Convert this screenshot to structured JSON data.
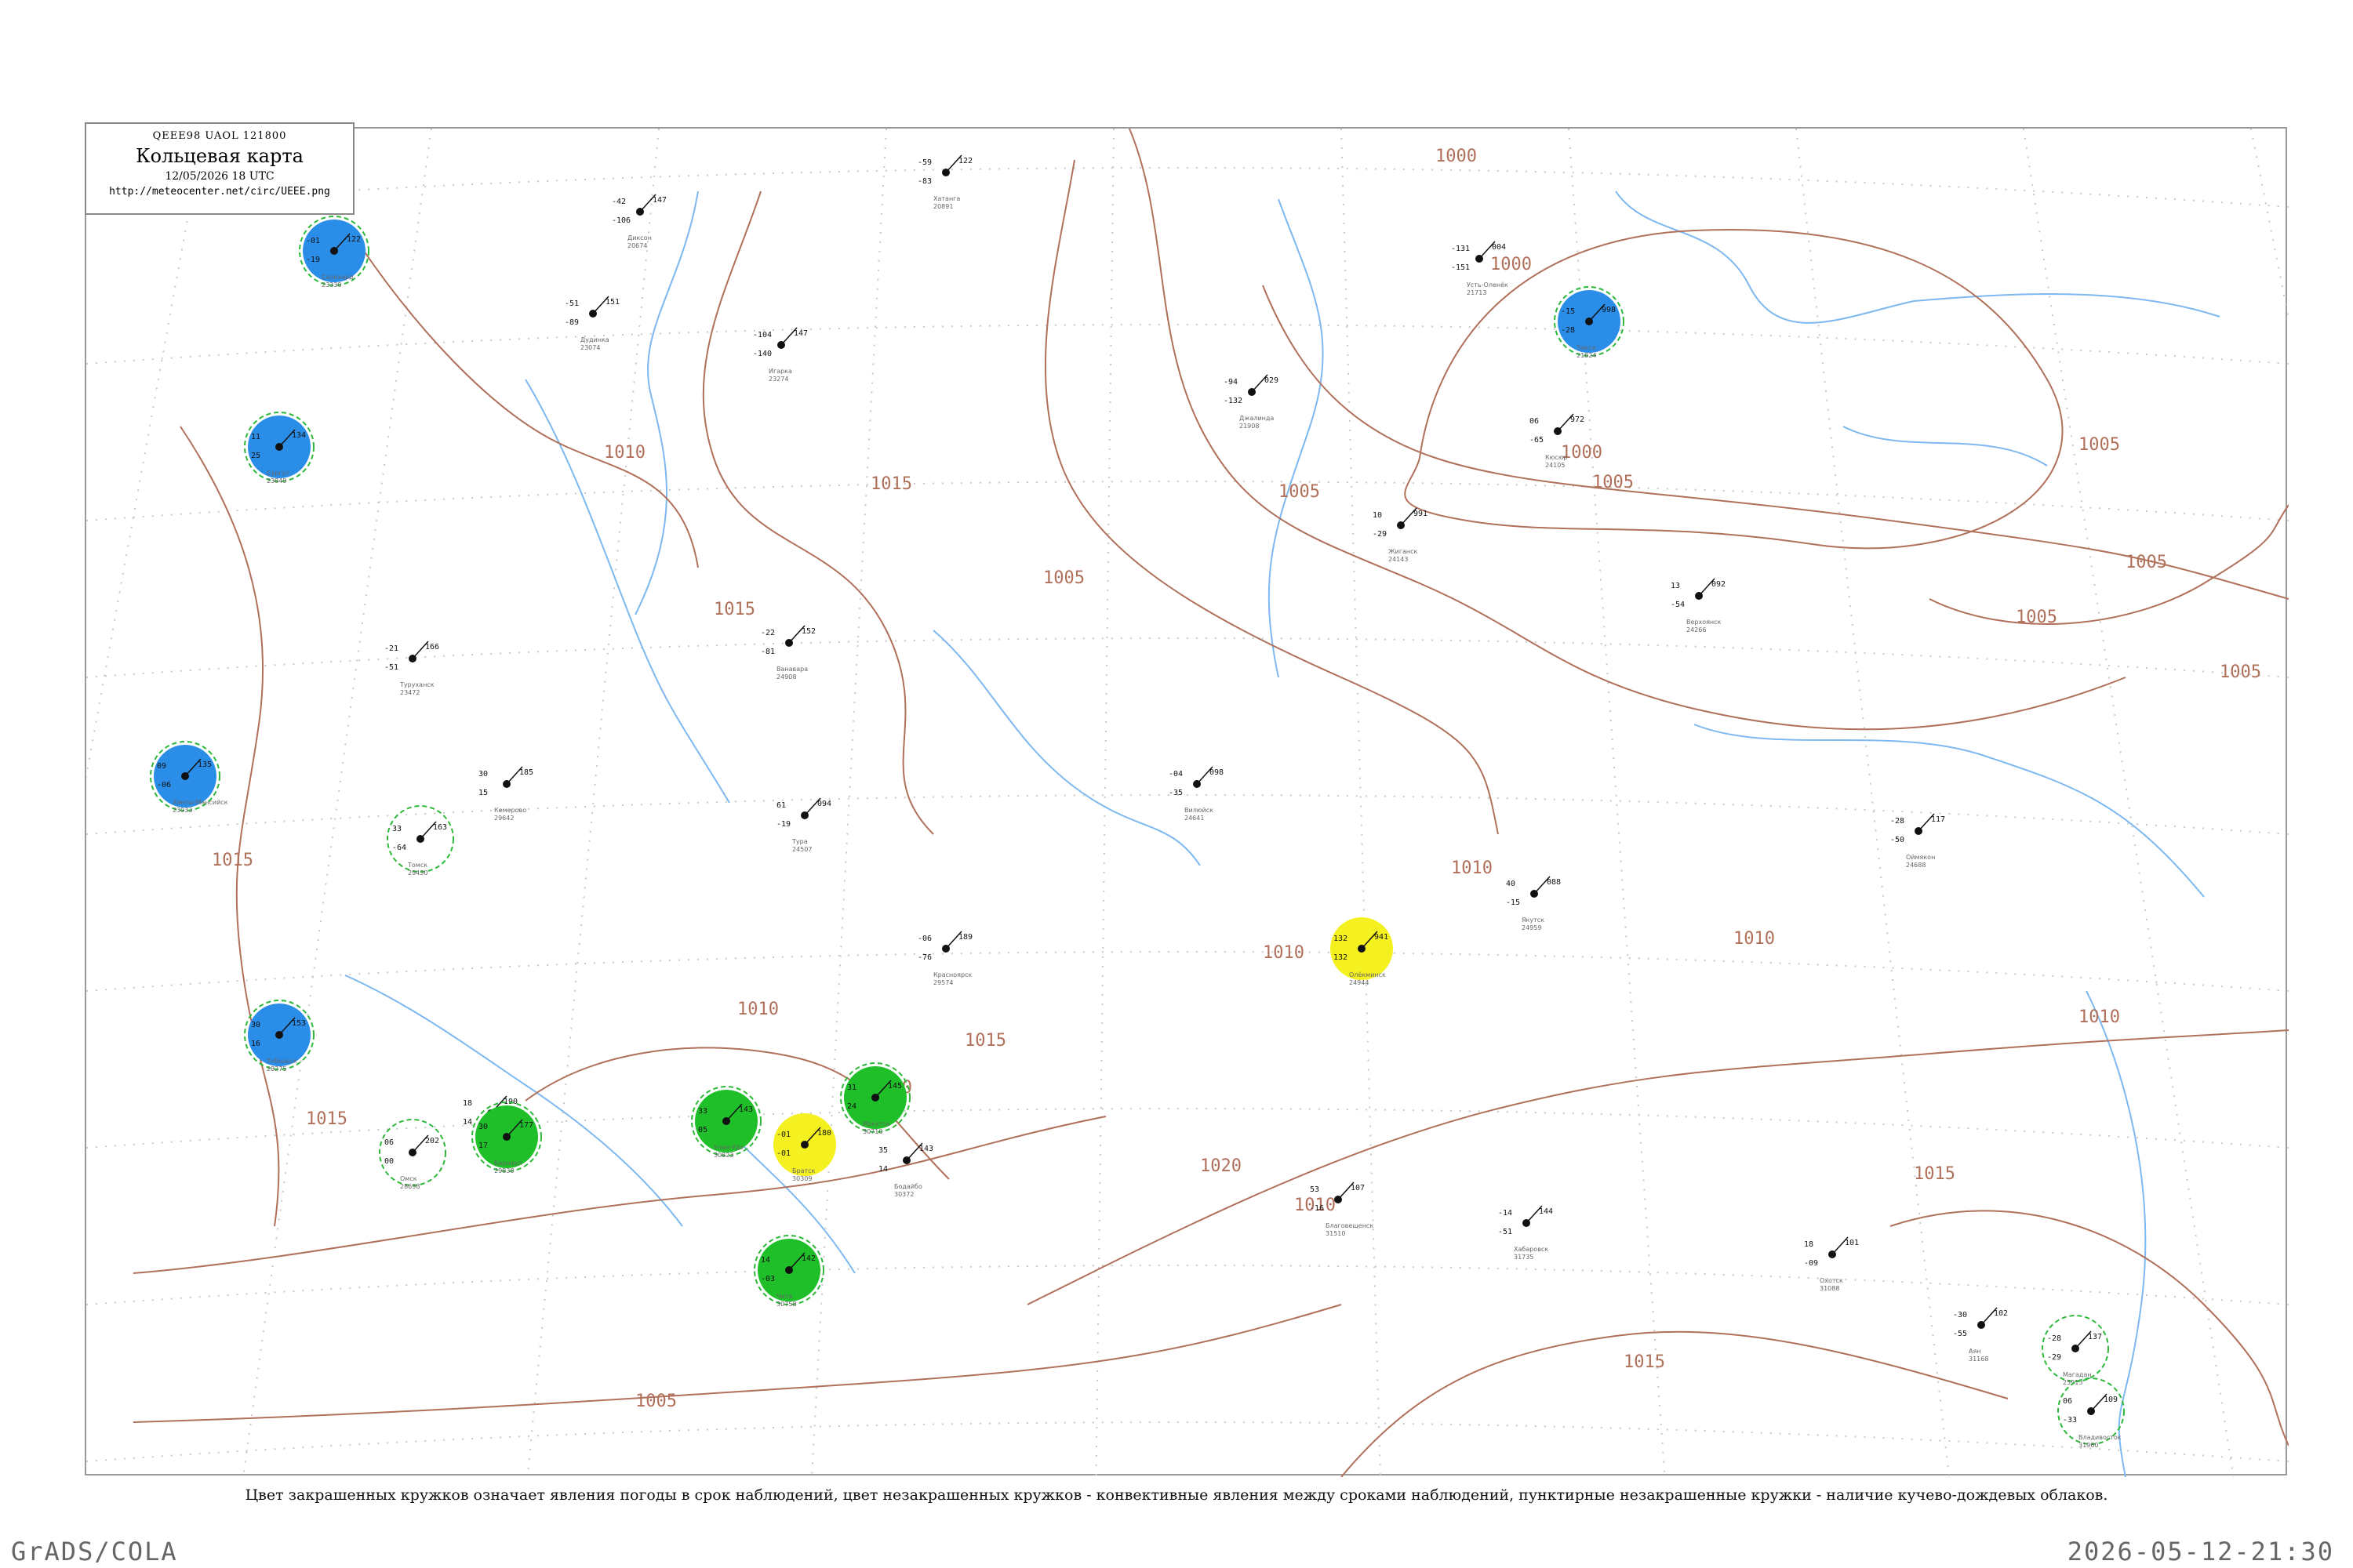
{
  "header": {
    "code_line": "QEEE98  UAOL  121800",
    "title": "Кольцевая карта",
    "date": "12/05/2026 18 UTC",
    "url": "http://meteocenter.net/circ/UEEE.png"
  },
  "caption": "Цвет закрашенных кружков означает явления погоды в срок наблюдений, цвет незакрашенных кружков - конвективные явления между сроками наблюдений, пунктирные незакрашенные кружки - наличие кучево-дождевых облаков.",
  "footer": {
    "left": "GrADS/COLA",
    "right": "2026-05-12-21:30"
  },
  "colors": {
    "isobar": "#b0705a",
    "river": "#7db8f0",
    "grid": "#c8c8c8",
    "blue_fill": "#2a8de8",
    "green_fill": "#1fbf2a",
    "yellow_fill": "#f5f020",
    "green_ring": "#2eb83a",
    "light_yellow": "#f8f5a8"
  },
  "isobar_labels": [
    "1000",
    "1000",
    "1000",
    "1005",
    "1005",
    "1005",
    "1005",
    "1005",
    "1005",
    "1005",
    "1010",
    "1010",
    "1010",
    "1010",
    "1010",
    "1010",
    "1010",
    "1010",
    "1015",
    "1015",
    "1015",
    "1015",
    "1015",
    "1015",
    "1015",
    "1020",
    "1005"
  ],
  "stations": [
    {
      "name": "Усть-Оленёк",
      "id": "21713",
      "pressure": "004",
      "temp": "-131",
      "dew": "-151",
      "kind": "none"
    },
    {
      "name": "Тикси",
      "id": "21824",
      "pressure": "998",
      "temp": "-15",
      "dew": "-28",
      "kind": "blue"
    },
    {
      "name": "Кюсюр",
      "id": "24105",
      "pressure": "972",
      "temp": "06",
      "dew": "-65",
      "kind": "none"
    },
    {
      "name": "Джалинда",
      "id": "21908",
      "pressure": "029",
      "temp": "-94",
      "dew": "-132",
      "kind": "none"
    },
    {
      "name": "Хатанга",
      "id": "20891",
      "pressure": "122",
      "temp": "-59",
      "dew": "-83",
      "kind": "none"
    },
    {
      "name": "Верхоянск",
      "id": "24266",
      "pressure": "092",
      "temp": "13",
      "dew": "-54",
      "kind": "none"
    },
    {
      "name": "Жиганск",
      "id": "24143",
      "pressure": "991",
      "temp": "10",
      "dew": "-29",
      "kind": "none"
    },
    {
      "name": "Оймякон",
      "id": "24688",
      "pressure": "117",
      "temp": "-28",
      "dew": "-50",
      "kind": "none"
    },
    {
      "name": "Якутск",
      "id": "24959",
      "pressure": "088",
      "temp": "40",
      "dew": "-15",
      "kind": "none"
    },
    {
      "name": "Олёкминск",
      "id": "24944",
      "pressure": "941",
      "temp": "132",
      "dew": "132",
      "kind": "yellow"
    },
    {
      "name": "Вилюйск",
      "id": "24641",
      "pressure": "098",
      "temp": "-04",
      "dew": "-35",
      "kind": "none"
    },
    {
      "name": "Тура",
      "id": "24507",
      "pressure": "094",
      "temp": "61",
      "dew": "-19",
      "kind": "none"
    },
    {
      "name": "Ванавара",
      "id": "24908",
      "pressure": "152",
      "temp": "-22",
      "dew": "-81",
      "kind": "none"
    },
    {
      "name": "Туруханск",
      "id": "23472",
      "pressure": "166",
      "temp": "-21",
      "dew": "-51",
      "kind": "none"
    },
    {
      "name": "Диксон",
      "id": "20674",
      "pressure": "147",
      "temp": "-42",
      "dew": "-106",
      "kind": "none"
    },
    {
      "name": "Дудинка",
      "id": "23074",
      "pressure": "151",
      "temp": "-51",
      "dew": "-89",
      "kind": "none"
    },
    {
      "name": "Игарка",
      "id": "23274",
      "pressure": "147",
      "temp": "-104",
      "dew": "-140",
      "kind": "none"
    },
    {
      "name": "Салехард",
      "id": "23330",
      "pressure": "122",
      "temp": "-01",
      "dew": "-19",
      "kind": "blue"
    },
    {
      "name": "Сургут",
      "id": "23849",
      "pressure": "134",
      "temp": "11",
      "dew": "25",
      "kind": "blue"
    },
    {
      "name": "Ханты-Мансийск",
      "id": "23933",
      "pressure": "135",
      "temp": "09",
      "dew": "-06",
      "kind": "blue"
    },
    {
      "name": "Тобольск",
      "id": "28275",
      "pressure": "153",
      "temp": "30",
      "dew": "16",
      "kind": "blue"
    },
    {
      "name": "Омск",
      "id": "28698",
      "pressure": "202",
      "temp": "06",
      "dew": "00",
      "kind": "green-ring"
    },
    {
      "name": "Новосибирск",
      "id": "29634",
      "pressure": "190",
      "temp": "18",
      "dew": "14",
      "kind": "none"
    },
    {
      "name": "Барнаул",
      "id": "29838",
      "pressure": "177",
      "temp": "30",
      "dew": "17",
      "kind": "green"
    },
    {
      "name": "Кемерово",
      "id": "29642",
      "pressure": "185",
      "temp": "30",
      "dew": "15",
      "kind": "none"
    },
    {
      "name": "Томск",
      "id": "29430",
      "pressure": "163",
      "temp": "33",
      "dew": "-64",
      "kind": "green-ring"
    },
    {
      "name": "Красноярск",
      "id": "29574",
      "pressure": "189",
      "temp": "-06",
      "dew": "-76",
      "kind": "none"
    },
    {
      "name": "Иркутск",
      "id": "30710",
      "pressure": "145",
      "temp": "31",
      "dew": "24",
      "kind": "green"
    },
    {
      "name": "Улан-Удэ",
      "id": "30823",
      "pressure": "143",
      "temp": "33",
      "dew": "05",
      "kind": "green"
    },
    {
      "name": "Чита",
      "id": "30758",
      "pressure": "142",
      "temp": "14",
      "dew": "-03",
      "kind": "green"
    },
    {
      "name": "Братск",
      "id": "30309",
      "pressure": "180",
      "temp": "-01",
      "dew": "-01",
      "kind": "yellow"
    },
    {
      "name": "Бодайбо",
      "id": "30372",
      "pressure": "143",
      "temp": "35",
      "dew": "14",
      "kind": "none"
    },
    {
      "name": "Благовещенск",
      "id": "31510",
      "pressure": "107",
      "temp": "53",
      "dew": "-16",
      "kind": "none"
    },
    {
      "name": "Хабаровск",
      "id": "31735",
      "pressure": "144",
      "temp": "-14",
      "dew": "-51",
      "kind": "none"
    },
    {
      "name": "Охотск",
      "id": "31088",
      "pressure": "101",
      "temp": "18",
      "dew": "-09",
      "kind": "none"
    },
    {
      "name": "Магадан",
      "id": "25913",
      "pressure": "137",
      "temp": "-28",
      "dew": "-29",
      "kind": "green-ring"
    },
    {
      "name": "Аян",
      "id": "31168",
      "pressure": "102",
      "temp": "-30",
      "dew": "-55",
      "kind": "none"
    },
    {
      "name": "Владивосток",
      "id": "31960",
      "pressure": "109",
      "temp": "06",
      "dew": "-33",
      "kind": "green-ring"
    }
  ]
}
